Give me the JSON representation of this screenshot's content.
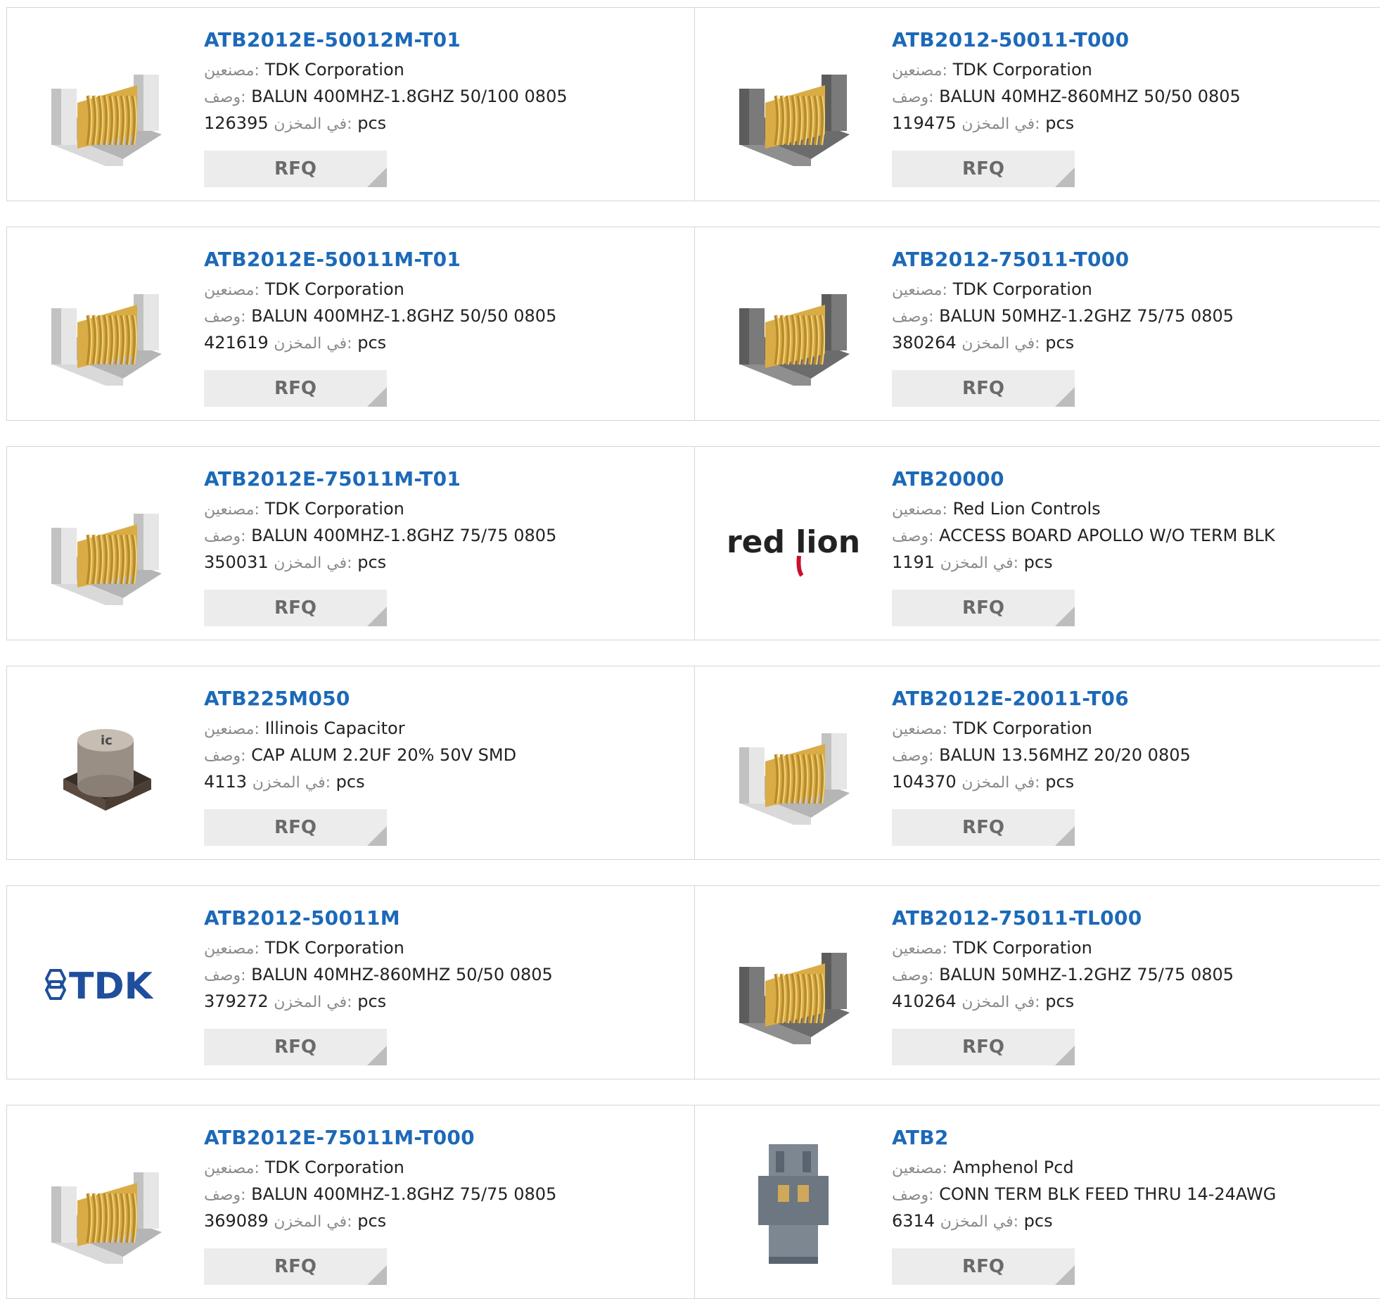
{
  "labels": {
    "manufacturer": "مصنعين:",
    "description": "وصف:",
    "stock": "في المخزن:",
    "unit": "pcs",
    "rfq": "RFQ"
  },
  "products": [
    {
      "pn": "ATB2012E-50012M-T01",
      "manufacturer": "TDK Corporation",
      "description": "BALUN 400MHZ-1.8GHZ 50/100 0805",
      "stock": "126395",
      "image": "white-coil-balun"
    },
    {
      "pn": "ATB2012-50011-T000",
      "manufacturer": "TDK Corporation",
      "description": "BALUN 40MHZ-860MHZ 50/50 0805",
      "stock": "119475",
      "image": "gray-coil-balun"
    },
    {
      "pn": "ATB2012E-50011M-T01",
      "manufacturer": "TDK Corporation",
      "description": "BALUN 400MHZ-1.8GHZ 50/50 0805",
      "stock": "421619",
      "image": "white-coil-balun"
    },
    {
      "pn": "ATB2012-75011-T000",
      "manufacturer": "TDK Corporation",
      "description": "BALUN 50MHZ-1.2GHZ 75/75 0805",
      "stock": "380264",
      "image": "gray-coil-balun"
    },
    {
      "pn": "ATB2012E-75011M-T01",
      "manufacturer": "TDK Corporation",
      "description": "BALUN 400MHZ-1.8GHZ 75/75 0805",
      "stock": "350031",
      "image": "white-coil-balun"
    },
    {
      "pn": "ATB20000",
      "manufacturer": "Red Lion Controls",
      "description": "ACCESS BOARD APOLLO W/O TERM BLK",
      "stock": "1191",
      "image": "red-lion-logo",
      "logo_text": "red lion"
    },
    {
      "pn": "ATB225M050",
      "manufacturer": "Illinois Capacitor",
      "description": "CAP ALUM 2.2UF 20% 50V SMD",
      "stock": "4113",
      "image": "smd-capacitor",
      "logo_text": "ic"
    },
    {
      "pn": "ATB2012E-20011-T06",
      "manufacturer": "TDK Corporation",
      "description": "BALUN 13.56MHZ 20/20 0805",
      "stock": "104370",
      "image": "white-coil-balun"
    },
    {
      "pn": "ATB2012-50011M",
      "manufacturer": "TDK Corporation",
      "description": "BALUN 40MHZ-860MHZ 50/50 0805",
      "stock": "379272",
      "image": "tdk-logo",
      "logo_text": "TDK"
    },
    {
      "pn": "ATB2012-75011-TL000",
      "manufacturer": "TDK Corporation",
      "description": "BALUN 50MHZ-1.2GHZ 75/75 0805",
      "stock": "410264",
      "image": "gray-coil-balun"
    },
    {
      "pn": "ATB2012E-75011M-T000",
      "manufacturer": "TDK Corporation",
      "description": "BALUN 400MHZ-1.8GHZ 75/75 0805",
      "stock": "369089",
      "image": "white-coil-balun"
    },
    {
      "pn": "ATB2",
      "manufacturer": "Amphenol Pcd",
      "description": "CONN TERM BLK FEED THRU 14-24AWG",
      "stock": "6314",
      "image": "terminal-block"
    }
  ]
}
